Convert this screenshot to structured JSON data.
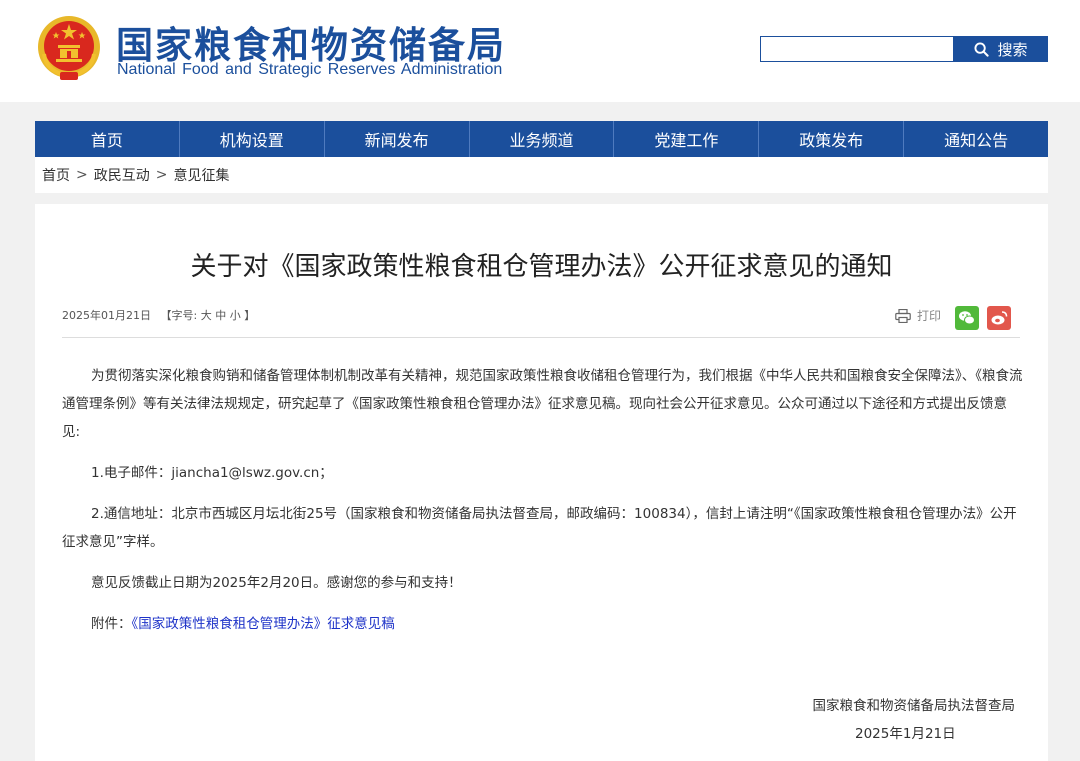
{
  "header": {
    "site_name_cn": "国家粮食和物资储备局",
    "site_name_en": "National Food and Strategic Reserves Administration",
    "search_placeholder": "",
    "search_label": "搜索"
  },
  "nav": {
    "items": [
      {
        "label": "首页"
      },
      {
        "label": "机构设置"
      },
      {
        "label": "新闻发布"
      },
      {
        "label": "业务频道"
      },
      {
        "label": "党建工作"
      },
      {
        "label": "政策发布"
      },
      {
        "label": "通知公告"
      }
    ]
  },
  "breadcrumb": {
    "items": [
      "首页",
      "政民互动",
      "意见征集"
    ],
    "separator": ">"
  },
  "article": {
    "title": "关于对《国家政策性粮食租仓管理办法》公开征求意见的通知",
    "date": "2025年01月21日",
    "font_size_prefix": "【字号:",
    "font_sizes": [
      "大",
      "中",
      "小"
    ],
    "font_size_suffix": "】",
    "print_label": "打印",
    "paragraph1": "为贯彻落实深化粮食购销和储备管理体制机制改革有关精神，规范国家政策性粮食收储租仓管理行为，我们根据《中华人民共和国粮食安全保障法》、《粮食流通管理条例》等有关法律法规规定，研究起草了《国家政策性粮食租仓管理办法》征求意见稿。现向社会公开征求意见。公众可通过以下途径和方式提出反馈意见:",
    "item1": "1.电子邮件：jiancha1@lswz.gov.cn；",
    "item2": "2.通信地址：北京市西城区月坛北街25号（国家粮食和物资储备局执法督查局，邮政编码：100834），信封上请注明“《国家政策性粮食租仓管理办法》公开征求意见”字样。",
    "deadline": "意见反馈截止日期为2025年2月20日。感谢您的参与和支持！",
    "attachment_label": "附件：",
    "attachment_link": "《国家政策性粮食租仓管理办法》征求意见稿",
    "sign_org": "国家粮食和物资储备局执法督查局",
    "sign_date": "2025年1月21日"
  },
  "colors": {
    "brand_blue": "#1b4f9c",
    "emblem_red": "#d9281e",
    "emblem_gold": "#f2c12e",
    "wechat_green": "#51b93a",
    "weibo_red": "#e2574c",
    "link_blue": "#1e33c8"
  },
  "icons": [
    "national-emblem-icon",
    "search-icon",
    "print-icon",
    "wechat-icon",
    "weibo-icon"
  ]
}
